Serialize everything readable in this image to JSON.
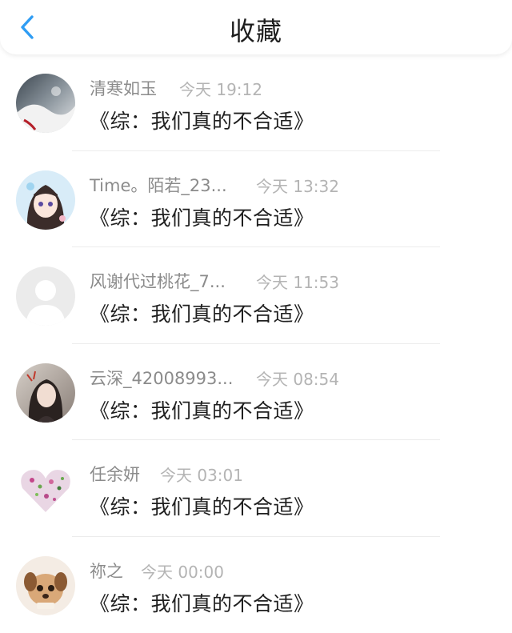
{
  "header": {
    "title": "收藏",
    "back_icon": "chevron-left-icon",
    "accent": "#2f9df4"
  },
  "items": [
    {
      "name": "清寒如玉",
      "time": "今天 19:12",
      "message": "《综：我们真的不合适》",
      "avatar": "landscape-avatar"
    },
    {
      "name": "Time。陌若_23...",
      "time": "今天 13:32",
      "message": "《综：我们真的不合适》",
      "avatar": "anime-girl-avatar"
    },
    {
      "name": "风谢代过桃花_7...",
      "time": "今天 11:53",
      "message": "《综：我们真的不合适》",
      "avatar": "default-user-avatar"
    },
    {
      "name": "云深_42008993...",
      "time": "今天 08:54",
      "message": "《综：我们真的不合适》",
      "avatar": "photo-girl-avatar"
    },
    {
      "name": "任余妍",
      "time": "今天 03:01",
      "message": "《综：我们真的不合适》",
      "avatar": "floral-heart-avatar"
    },
    {
      "name": "祢之",
      "time": "今天 00:00",
      "message": "《综：我们真的不合适》",
      "avatar": "puppy-avatar"
    }
  ]
}
